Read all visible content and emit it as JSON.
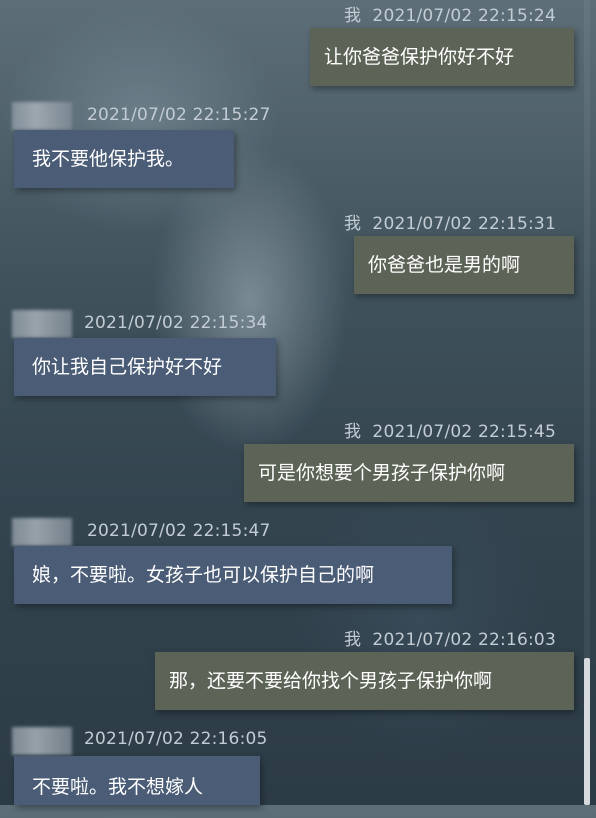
{
  "chat": {
    "messages": [
      {
        "sender": "我",
        "time": "2021/07/02  22:15:24",
        "text": "让你爸爸保护你好不好"
      },
      {
        "sender": "",
        "time": "2021/07/02  22:15:27",
        "text": "我不要他保护我。"
      },
      {
        "sender": "我",
        "time": "2021/07/02  22:15:31",
        "text": "你爸爸也是男的啊"
      },
      {
        "sender": "",
        "time": "2021/07/02  22:15:34",
        "text": "你让我自己保护好不好"
      },
      {
        "sender": "我",
        "time": "2021/07/02  22:15:45",
        "text": "可是你想要个男孩子保护你啊"
      },
      {
        "sender": "",
        "time": "2021/07/02  22:15:47",
        "text": "娘，不要啦。女孩子也可以保护自己的啊"
      },
      {
        "sender": "我",
        "time": "2021/07/02  22:16:03",
        "text": "那，还要不要给你找个男孩子保护你啊"
      },
      {
        "sender": "",
        "time": "2021/07/02  22:16:05",
        "text": "不要啦。我不想嫁人"
      }
    ]
  },
  "colors": {
    "my_bubble": "#5c6457",
    "their_bubble": "#4a5c76",
    "meta_text": "#c3ccd3"
  }
}
